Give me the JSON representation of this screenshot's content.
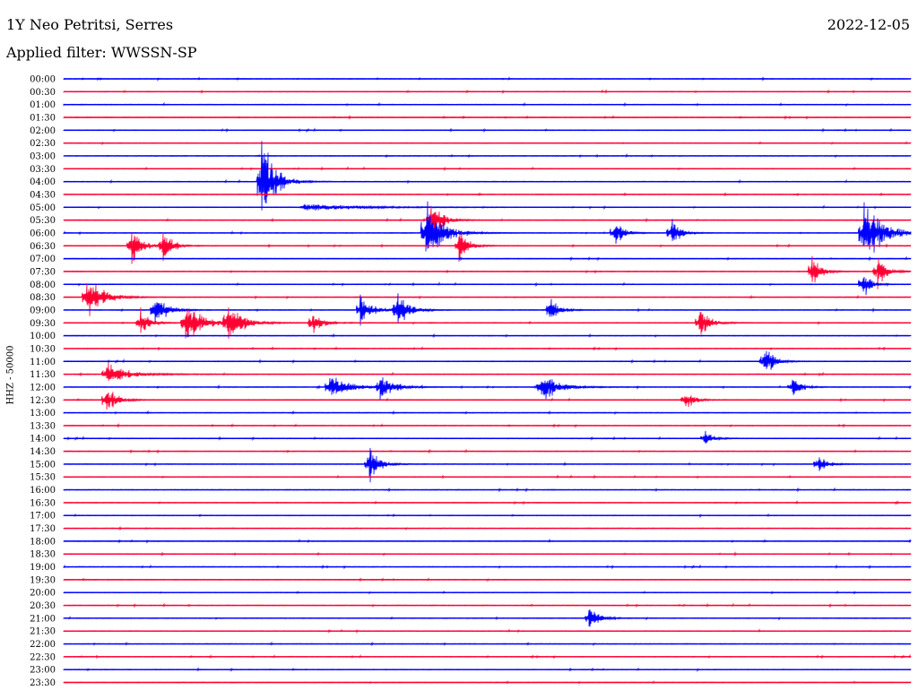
{
  "header": {
    "station": "1Y Neo Petritsi, Serres",
    "date": "2022-12-05",
    "filter": "Applied filter: WWSSN-SP"
  },
  "chart_data": {
    "type": "line",
    "title": "1Y Neo Petritsi, Serres",
    "subtitle": "Applied filter: WWSSN-SP",
    "date": "2022-12-05",
    "ylabel": "HHZ - 50000",
    "xlabel": "",
    "row_labels": [
      "00:00",
      "00:30",
      "01:00",
      "01:30",
      "02:00",
      "02:30",
      "03:00",
      "03:30",
      "04:00",
      "04:30",
      "05:00",
      "05:30",
      "06:00",
      "06:30",
      "07:00",
      "07:30",
      "08:00",
      "08:30",
      "09:00",
      "09:30",
      "10:00",
      "10:30",
      "11:00",
      "11:30",
      "12:00",
      "12:30",
      "13:00",
      "13:30",
      "14:00",
      "14:30",
      "15:00",
      "15:30",
      "16:00",
      "16:30",
      "17:00",
      "17:30",
      "18:00",
      "18:30",
      "19:00",
      "19:30",
      "20:00",
      "20:30",
      "21:00",
      "21:30",
      "22:00",
      "22:30",
      "23:00",
      "23:30"
    ],
    "row_minutes": 30,
    "trace_colors": [
      "#0000ff",
      "#ff0033"
    ],
    "events": [
      {
        "row": "04:00",
        "minute": 7.0,
        "amplitude": 6.0,
        "duration_min": 0.9
      },
      {
        "row": "05:00",
        "minute": 8.5,
        "amplitude": 0.5,
        "duration_min": 3.5
      },
      {
        "row": "05:30",
        "minute": 13.0,
        "amplitude": 3.0,
        "duration_min": 0.7
      },
      {
        "row": "06:00",
        "minute": 12.8,
        "amplitude": 4.5,
        "duration_min": 1.1
      },
      {
        "row": "06:00",
        "minute": 19.5,
        "amplitude": 2.0,
        "duration_min": 0.6
      },
      {
        "row": "06:00",
        "minute": 21.5,
        "amplitude": 2.0,
        "duration_min": 0.6
      },
      {
        "row": "06:00",
        "minute": 28.3,
        "amplitude": 4.5,
        "duration_min": 1.3
      },
      {
        "row": "06:30",
        "minute": 2.4,
        "amplitude": 2.5,
        "duration_min": 0.7
      },
      {
        "row": "06:30",
        "minute": 3.5,
        "amplitude": 2.5,
        "duration_min": 0.6
      },
      {
        "row": "06:30",
        "minute": 14.0,
        "amplitude": 2.5,
        "duration_min": 0.6
      },
      {
        "row": "07:30",
        "minute": 26.5,
        "amplitude": 2.2,
        "duration_min": 0.6
      },
      {
        "row": "07:30",
        "minute": 28.8,
        "amplitude": 2.5,
        "duration_min": 0.6
      },
      {
        "row": "08:00",
        "minute": 28.3,
        "amplitude": 2.0,
        "duration_min": 0.5
      },
      {
        "row": "08:30",
        "minute": 0.8,
        "amplitude": 3.5,
        "duration_min": 1.0
      },
      {
        "row": "09:00",
        "minute": 3.2,
        "amplitude": 2.5,
        "duration_min": 0.8
      },
      {
        "row": "09:00",
        "minute": 10.5,
        "amplitude": 2.5,
        "duration_min": 0.7
      },
      {
        "row": "09:00",
        "minute": 11.8,
        "amplitude": 2.5,
        "duration_min": 0.8
      },
      {
        "row": "09:00",
        "minute": 17.2,
        "amplitude": 2.0,
        "duration_min": 0.6
      },
      {
        "row": "09:30",
        "minute": 2.7,
        "amplitude": 2.0,
        "duration_min": 0.6
      },
      {
        "row": "09:30",
        "minute": 4.3,
        "amplitude": 3.0,
        "duration_min": 1.2
      },
      {
        "row": "09:30",
        "minute": 5.8,
        "amplitude": 3.0,
        "duration_min": 1.0
      },
      {
        "row": "09:30",
        "minute": 8.8,
        "amplitude": 2.0,
        "duration_min": 0.6
      },
      {
        "row": "09:30",
        "minute": 22.5,
        "amplitude": 2.2,
        "duration_min": 0.7
      },
      {
        "row": "11:00",
        "minute": 24.8,
        "amplitude": 2.5,
        "duration_min": 0.6
      },
      {
        "row": "11:30",
        "minute": 1.5,
        "amplitude": 1.5,
        "duration_min": 1.5
      },
      {
        "row": "12:00",
        "minute": 9.4,
        "amplitude": 2.0,
        "duration_min": 1.2
      },
      {
        "row": "12:00",
        "minute": 11.2,
        "amplitude": 2.0,
        "duration_min": 0.9
      },
      {
        "row": "12:00",
        "minute": 16.9,
        "amplitude": 2.0,
        "duration_min": 1.2
      },
      {
        "row": "12:00",
        "minute": 25.8,
        "amplitude": 1.5,
        "duration_min": 0.6
      },
      {
        "row": "12:30",
        "minute": 1.5,
        "amplitude": 2.0,
        "duration_min": 0.7
      },
      {
        "row": "12:30",
        "minute": 22.0,
        "amplitude": 1.5,
        "duration_min": 0.6
      },
      {
        "row": "14:00",
        "minute": 22.7,
        "amplitude": 1.5,
        "duration_min": 0.5
      },
      {
        "row": "15:00",
        "minute": 10.8,
        "amplitude": 2.5,
        "duration_min": 0.7
      },
      {
        "row": "15:00",
        "minute": 26.7,
        "amplitude": 1.5,
        "duration_min": 0.6
      },
      {
        "row": "21:00",
        "minute": 18.6,
        "amplitude": 1.5,
        "duration_min": 0.7
      }
    ]
  }
}
